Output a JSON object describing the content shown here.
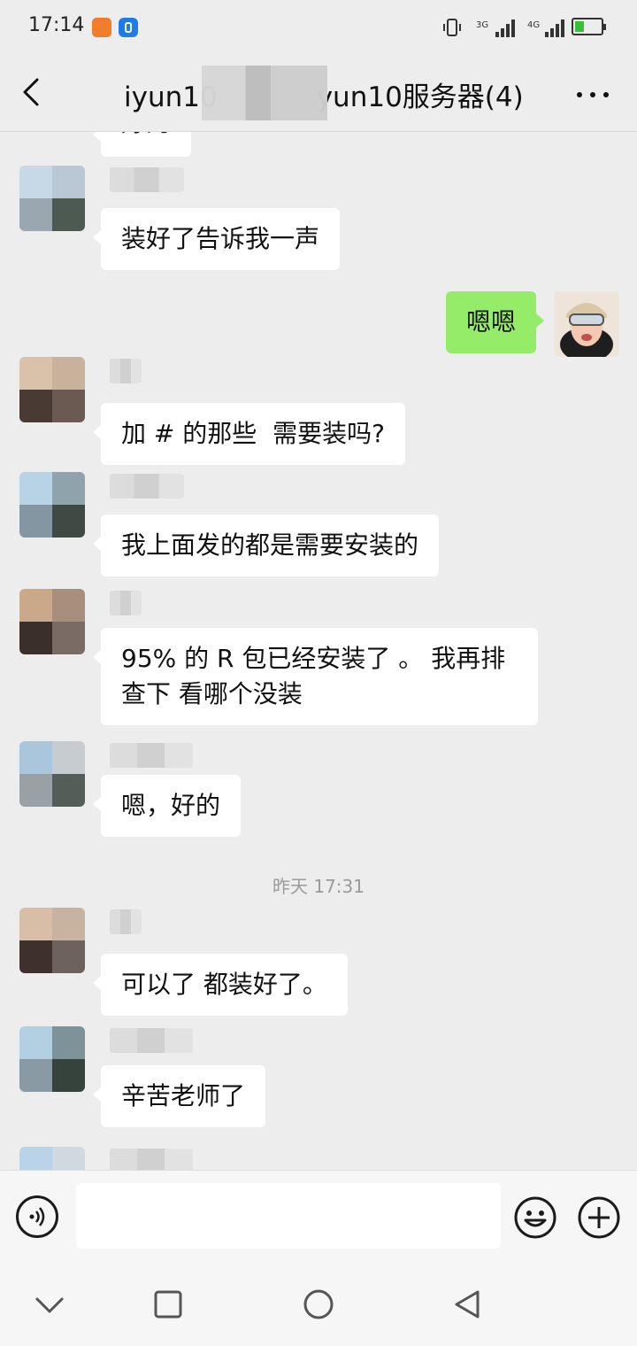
{
  "status_bar": {
    "time": "17:14",
    "signal_1_label": "3G",
    "signal_2_label": "4G",
    "icons": [
      "app-notification-icon",
      "browser-icon",
      "vibrate-icon",
      "signal-3g-icon",
      "signal-4g-icon",
      "battery-charging-icon"
    ]
  },
  "header": {
    "title_left": "iyun10",
    "title_right": "yun10服务器(4)",
    "back_icon": "back-arrow-icon",
    "more_icon": "more-dots-icon"
  },
  "messages": [
    {
      "text": "好的",
      "side": "in"
    },
    {
      "text": "装好了告诉我一声",
      "side": "in"
    },
    {
      "text": "嗯嗯",
      "side": "out"
    },
    {
      "text": "加 # 的那些  需要装吗?",
      "side": "in"
    },
    {
      "text": "我上面发的都是需要安装的",
      "side": "in"
    },
    {
      "text": "95% 的 R 包已经安装了 。 我再排\n查下 看哪个没装",
      "side": "in"
    },
    {
      "text": "嗯，好的",
      "side": "in"
    },
    {
      "text": "可以了 都装好了。",
      "side": "in"
    },
    {
      "text": "辛苦老师了",
      "side": "in"
    }
  ],
  "timestamp": "昨天 17:31",
  "input_bar": {
    "voice_icon": "voice-icon",
    "input_value": "",
    "emoji_icon": "emoji-icon",
    "plus_icon": "plus-icon"
  },
  "nav_bar": {
    "icons": [
      "nav-down-icon",
      "nav-recents-icon",
      "nav-home-icon",
      "nav-back-icon"
    ]
  },
  "colors": {
    "background": "#ededed",
    "incoming_bubble": "#ffffff",
    "outgoing_bubble": "#95ec69"
  }
}
